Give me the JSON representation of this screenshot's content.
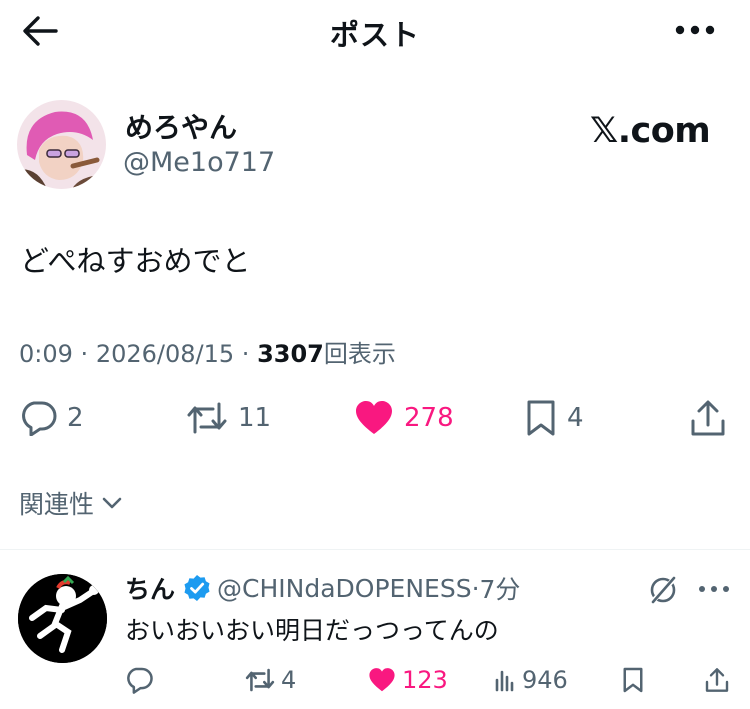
{
  "header": {
    "title": "ポスト"
  },
  "author": {
    "display_name": "めろやん",
    "handle": "@Me1o717"
  },
  "brand": {
    "label": "𝕏.com"
  },
  "post": {
    "text": "どぺねすおめでと",
    "time": "0:09",
    "date": "2026/08/15",
    "views_count": "3307",
    "views_label": "回表示",
    "separator": "·"
  },
  "actions": {
    "replies": "2",
    "reposts": "11",
    "likes": "278",
    "bookmarks": "4"
  },
  "related": {
    "label": "関連性"
  },
  "reply": {
    "name": "ちん",
    "handle": "@CHINdaDOPENESS",
    "separator": "·",
    "time": "7分",
    "text": "おいおいおい明日だっつってんの",
    "reposts": "4",
    "likes": "123",
    "views": "946"
  },
  "colors": {
    "like_pink": "#f91880",
    "verified_blue": "#1d9bf0",
    "secondary_text": "#536471"
  },
  "icons": [
    "back-arrow-icon",
    "more-icon",
    "reply-icon",
    "repost-icon",
    "heart-icon",
    "bookmark-icon",
    "share-icon",
    "chevron-down-icon",
    "verified-badge-icon",
    "grok-icon",
    "views-icon"
  ]
}
